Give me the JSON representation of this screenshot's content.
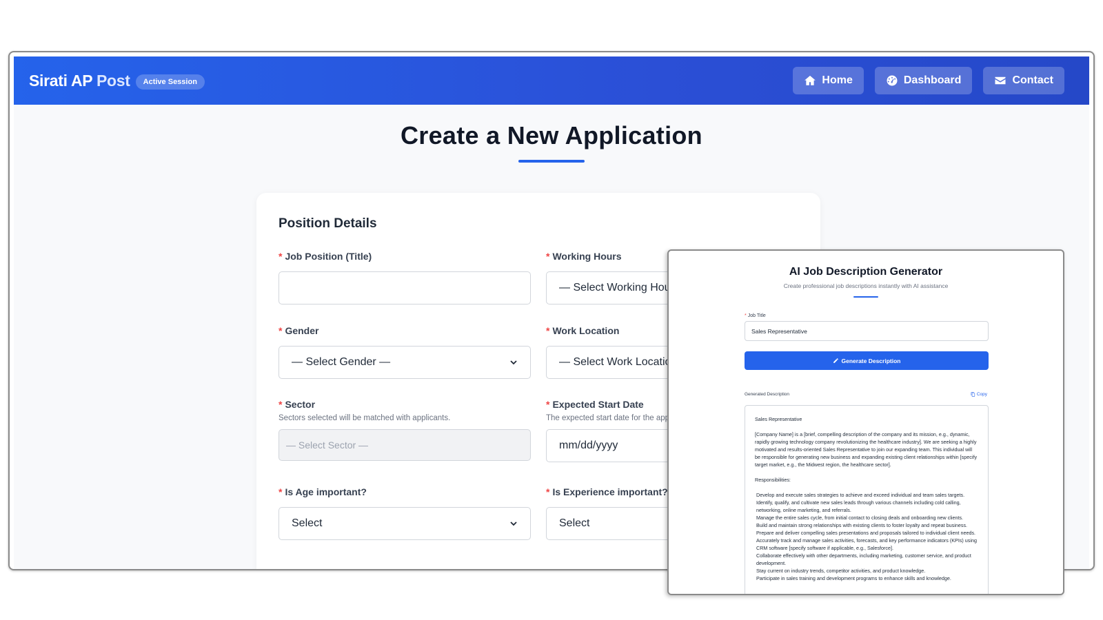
{
  "navbar": {
    "brand_main": "Sirati AP",
    "brand_accent": "Post",
    "session_badge": "Active Session",
    "links": [
      {
        "label": "Home",
        "icon": "home-icon"
      },
      {
        "label": "Dashboard",
        "icon": "dashboard-icon"
      },
      {
        "label": "Contact",
        "icon": "envelope-icon"
      }
    ]
  },
  "page": {
    "title": "Create a New Application"
  },
  "form": {
    "section_title": "Position Details",
    "job_position": {
      "label": "Job Position (Title)",
      "value": ""
    },
    "working_hours": {
      "label": "Working Hours",
      "value": "— Select Working Hours —"
    },
    "gender": {
      "label": "Gender",
      "value": "— Select Gender —"
    },
    "work_location": {
      "label": "Work Location",
      "value": "— Select Work Location —"
    },
    "sector": {
      "label": "Sector",
      "hint": "Sectors selected will be matched with applicants.",
      "value": "— Select Sector —"
    },
    "start_date": {
      "label": "Expected Start Date",
      "hint": "The expected start date for the applicant.",
      "placeholder": "mm/dd/yyyy"
    },
    "age_important": {
      "label": "Is Age important?",
      "value": "Select"
    },
    "experience_important": {
      "label": "Is Experience important?",
      "value": "Select"
    }
  },
  "ai_generator": {
    "title": "AI Job Description Generator",
    "subtitle": "Create professional job descriptions instantly with AI assistance",
    "job_title_label": "Job Title",
    "job_title_value": "Sales Representative",
    "generate_button": "Generate Description",
    "generated_label": "Generated Description",
    "copy_label": "Copy",
    "description": {
      "heading": "Sales Representative",
      "intro": "[Company Name] is a [brief, compelling description of the company and its mission, e.g., dynamic, rapidly growing technology company revolutionizing the healthcare industry]. We are seeking a highly motivated and results-oriented Sales Representative to join our expanding team. This individual will be responsible for generating new business and expanding existing client relationships within [specify target market, e.g., the Midwest region, the healthcare sector].",
      "responsibilities_heading": "Responsibilities:",
      "responsibilities": [
        "Develop and execute sales strategies to achieve and exceed individual and team sales targets.",
        "Identify, qualify, and cultivate new sales leads through various channels including cold calling, networking, online marketing, and referrals.",
        "Manage the entire sales cycle, from initial contact to closing deals and onboarding new clients.",
        "Build and maintain strong relationships with existing clients to foster loyalty and repeat business.",
        "Prepare and deliver compelling sales presentations and proposals tailored to individual client needs.",
        "Accurately track and manage sales activities, forecasts, and key performance indicators (KPIs) using CRM software [specify software if applicable, e.g., Salesforce].",
        "Collaborate effectively with other departments, including marketing, customer service, and product development.",
        "Stay current on industry trends, competitor activities, and product knowledge.",
        "Participate in sales training and development programs to enhance skills and knowledge."
      ]
    }
  }
}
